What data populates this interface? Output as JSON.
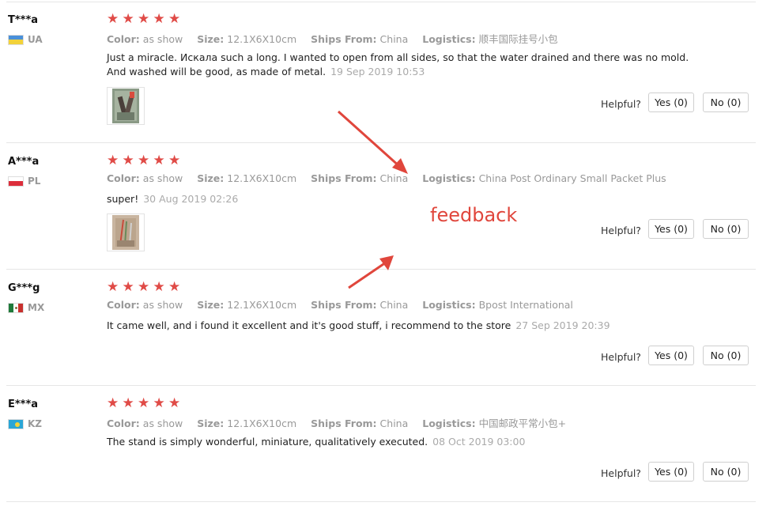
{
  "helpful_label": "Helpful?",
  "annotation": {
    "text": "feedback",
    "color": "#e0463c"
  },
  "reviews": [
    {
      "user": "T***a",
      "country": "UA",
      "rating": 5,
      "color_label": "Color:",
      "color_value": "as show",
      "size_label": "Size:",
      "size_value": "12.1X6X10cm",
      "ships_label": "Ships From:",
      "ships_value": "China",
      "logistics_label": "Logistics:",
      "logistics_value": "顺丰国际挂号小包",
      "text_line1": "Just a miracle. Искала such a long. I wanted to open from all sides, so that the water drained and there was no mold.",
      "text_line2": "And washed will be good, as made of metal.",
      "date": "19 Sep 2019 10:53",
      "yes": "Yes (0)",
      "no": "No (0)"
    },
    {
      "user": "A***a",
      "country": "PL",
      "rating": 5,
      "color_label": "Color:",
      "color_value": "as show",
      "size_label": "Size:",
      "size_value": "12.1X6X10cm",
      "ships_label": "Ships From:",
      "ships_value": "China",
      "logistics_label": "Logistics:",
      "logistics_value": "China Post Ordinary Small Packet Plus",
      "text": "super!",
      "date": "30 Aug 2019 02:26",
      "yes": "Yes (0)",
      "no": "No (0)"
    },
    {
      "user": "G***g",
      "country": "MX",
      "rating": 5,
      "color_label": "Color:",
      "color_value": "as show",
      "size_label": "Size:",
      "size_value": "12.1X6X10cm",
      "ships_label": "Ships From:",
      "ships_value": "China",
      "logistics_label": "Logistics:",
      "logistics_value": "Bpost International",
      "text": "It came well, and i found it excellent and it's good stuff, i recommend to the store",
      "date": "27 Sep 2019 20:39",
      "yes": "Yes (0)",
      "no": "No (0)"
    },
    {
      "user": "E***a",
      "country": "KZ",
      "rating": 5,
      "color_label": "Color:",
      "color_value": "as show",
      "size_label": "Size:",
      "size_value": "12.1X6X10cm",
      "ships_label": "Ships From:",
      "ships_value": "China",
      "logistics_label": "Logistics:",
      "logistics_value": "中国邮政平常小包+",
      "text": "The stand is simply wonderful, miniature, qualitatively executed.",
      "date": "08 Oct 2019 03:00",
      "yes": "Yes (0)",
      "no": "No (0)"
    }
  ]
}
